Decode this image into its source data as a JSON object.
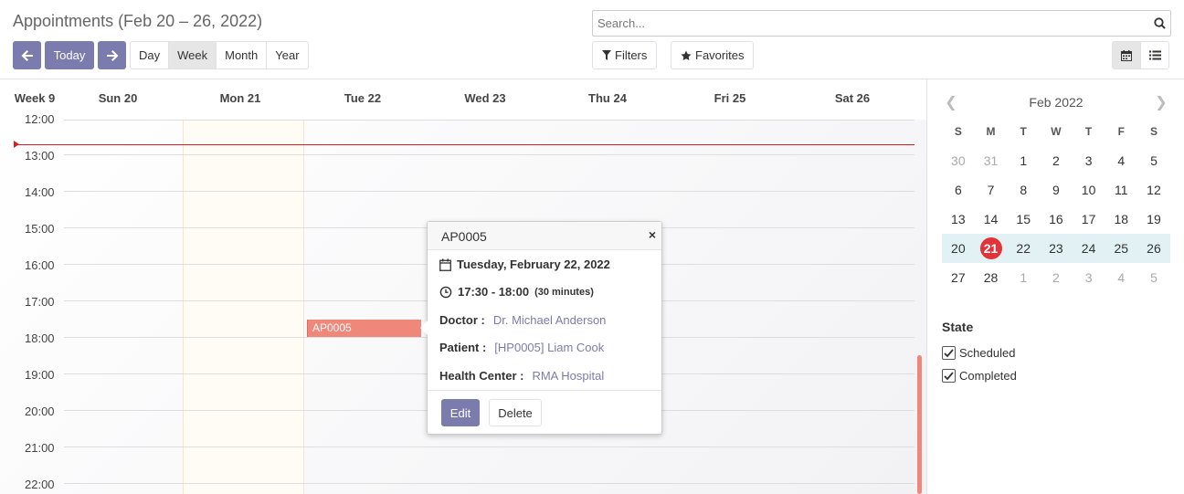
{
  "header": {
    "title": "Appointments (Feb 20 – 26, 2022)",
    "today_label": "Today",
    "scales": [
      "Day",
      "Week",
      "Month",
      "Year"
    ],
    "active_scale": "Week",
    "search_placeholder": "Search...",
    "filters_label": "Filters",
    "favorites_label": "Favorites"
  },
  "week": {
    "week_label": "Week 9",
    "days": [
      "Sun 20",
      "Mon 21",
      "Tue 22",
      "Wed 23",
      "Thu 24",
      "Fri 25",
      "Sat 26"
    ],
    "hours": [
      "12:00",
      "13:00",
      "14:00",
      "15:00",
      "16:00",
      "17:00",
      "18:00",
      "19:00",
      "20:00",
      "21:00",
      "22:00"
    ],
    "events": [
      {
        "label": "AP0005",
        "day": "Tue 22",
        "start": "17:30",
        "end": "18:00",
        "color": "#f0877b"
      }
    ]
  },
  "popover": {
    "title": "AP0005",
    "date": "Tuesday, February 22, 2022",
    "time": "17:30 - 18:00",
    "duration": "(30 minutes)",
    "doctor_label": "Doctor :",
    "doctor": "Dr. Michael Anderson",
    "patient_label": "Patient :",
    "patient": "[HP0005] Liam Cook",
    "center_label": "Health Center :",
    "center": "RMA Hospital",
    "edit_label": "Edit",
    "delete_label": "Delete"
  },
  "mini_calendar": {
    "title": "Feb 2022",
    "weekdays": [
      "S",
      "M",
      "T",
      "W",
      "T",
      "F",
      "S"
    ],
    "weeks": [
      [
        "30",
        "31",
        "1",
        "2",
        "3",
        "4",
        "5"
      ],
      [
        "6",
        "7",
        "8",
        "9",
        "10",
        "11",
        "12"
      ],
      [
        "13",
        "14",
        "15",
        "16",
        "17",
        "18",
        "19"
      ],
      [
        "20",
        "21",
        "22",
        "23",
        "24",
        "25",
        "26"
      ],
      [
        "27",
        "28",
        "1",
        "2",
        "3",
        "4",
        "5"
      ]
    ],
    "today": "21"
  },
  "state_filter": {
    "title": "State",
    "options": [
      {
        "label": "Scheduled",
        "checked": true
      },
      {
        "label": "Completed",
        "checked": true
      }
    ]
  },
  "colors": {
    "primary": "#7c7bad",
    "event": "#f0877b",
    "now_line": "#d81e1e",
    "today_badge": "#e3333a"
  }
}
